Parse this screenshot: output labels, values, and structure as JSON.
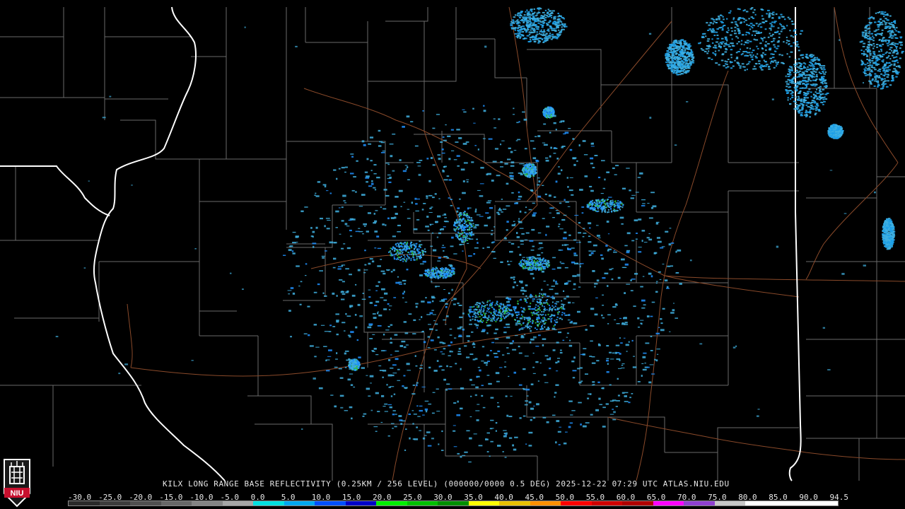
{
  "caption": "KILX LONG RANGE BASE REFLECTIVITY (0.25KM / 256 LEVEL) (000000/0000 0.5 DEG) 2025-12-22 07:29 UTC  ATLAS.NIU.EDU",
  "logo_text": "NIU",
  "legend": {
    "ticks": [
      "-30.0",
      "-25.0",
      "-20.0",
      "-15.0",
      "-10.0",
      "-5.0",
      "0.0",
      "5.0",
      "10.0",
      "15.0",
      "20.0",
      "25.0",
      "30.0",
      "35.0",
      "40.0",
      "45.0",
      "50.0",
      "55.0",
      "60.0",
      "65.0",
      "70.0",
      "75.0",
      "80.0",
      "85.0",
      "90.0",
      "94.5"
    ],
    "colors": [
      "#2a2a2a",
      "#3c3c3c",
      "#505050",
      "#686868",
      "#848484",
      "#a6a6a6",
      "#00e0e0",
      "#00a8f0",
      "#0050ff",
      "#0000c8",
      "#00f000",
      "#00c000",
      "#009000",
      "#ffff00",
      "#e8c000",
      "#ff9000",
      "#ff0000",
      "#d00000",
      "#b00000",
      "#ff00ff",
      "#9040d0",
      "#c8c8c8",
      "#ffffff",
      "#ffffff",
      "#ffffff"
    ]
  },
  "colors": {
    "background": "#000000",
    "county_lines": "#6a6a6a",
    "state_lines": "#ffffff",
    "roads": "#8a4a2a",
    "echo_light": "#40b0e0",
    "echo_medium": "#1e90ff",
    "echo_strong": "#30c030"
  }
}
